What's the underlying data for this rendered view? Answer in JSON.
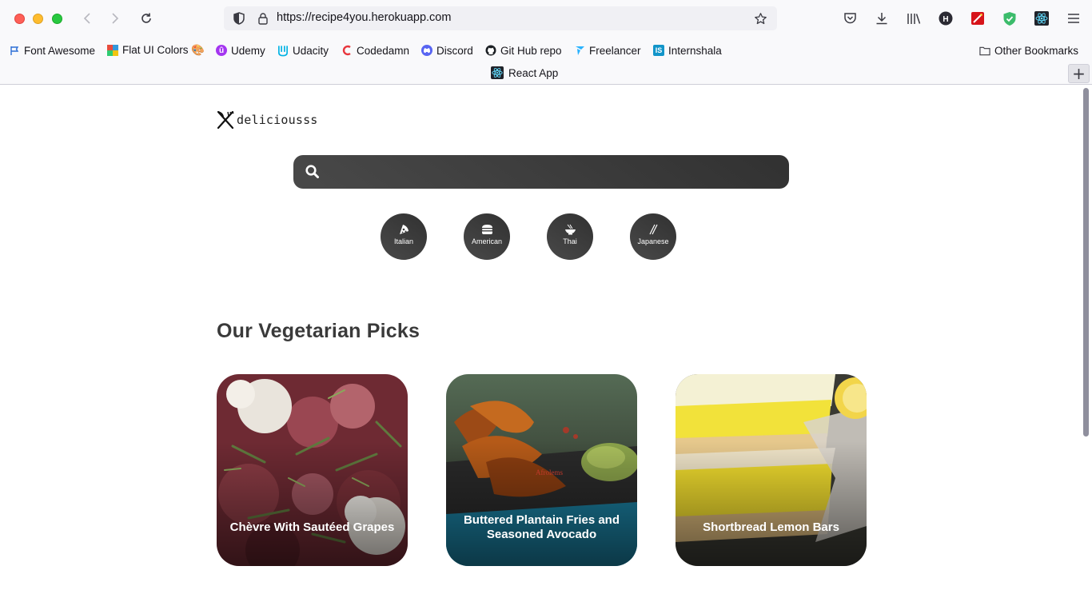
{
  "browser": {
    "url": "https://recipe4you.herokuapp.com",
    "tab_title": "React App",
    "bookmarks": [
      {
        "label": "Font Awesome",
        "icon": "flag-icon"
      },
      {
        "label": "Flat UI Colors 🎨",
        "icon": "flatuicolors-icon"
      },
      {
        "label": "Udemy",
        "icon": "udemy-icon"
      },
      {
        "label": "Udacity",
        "icon": "udacity-icon"
      },
      {
        "label": "Codedamn",
        "icon": "codedamn-icon"
      },
      {
        "label": "Discord",
        "icon": "discord-icon"
      },
      {
        "label": "Git Hub repo",
        "icon": "github-icon"
      },
      {
        "label": "Freelancer",
        "icon": "freelancer-icon"
      },
      {
        "label": "Internshala",
        "icon": "internshala-icon"
      }
    ],
    "other_bookmarks": "Other Bookmarks"
  },
  "page": {
    "logo_text": "deliciousss",
    "search": {
      "placeholder": "",
      "value": ""
    },
    "cuisines": [
      {
        "label": "Italian",
        "icon": "pizza-icon"
      },
      {
        "label": "American",
        "icon": "hamburger-icon"
      },
      {
        "label": "Thai",
        "icon": "noodle-bowl-icon"
      },
      {
        "label": "Japanese",
        "icon": "chopsticks-icon"
      }
    ],
    "section_title": "Our Vegetarian Picks",
    "picks": [
      {
        "title": "Chèvre With Sautéed Grapes"
      },
      {
        "title": "Buttered Plantain Fries and Seasoned Avocado",
        "watermark": "Afrolems"
      },
      {
        "title": "Shortbread Lemon Bars"
      }
    ]
  },
  "colors": {
    "search_bg": "#313131",
    "cuisine_bg": "#313131",
    "accent": "#fe5f57"
  }
}
